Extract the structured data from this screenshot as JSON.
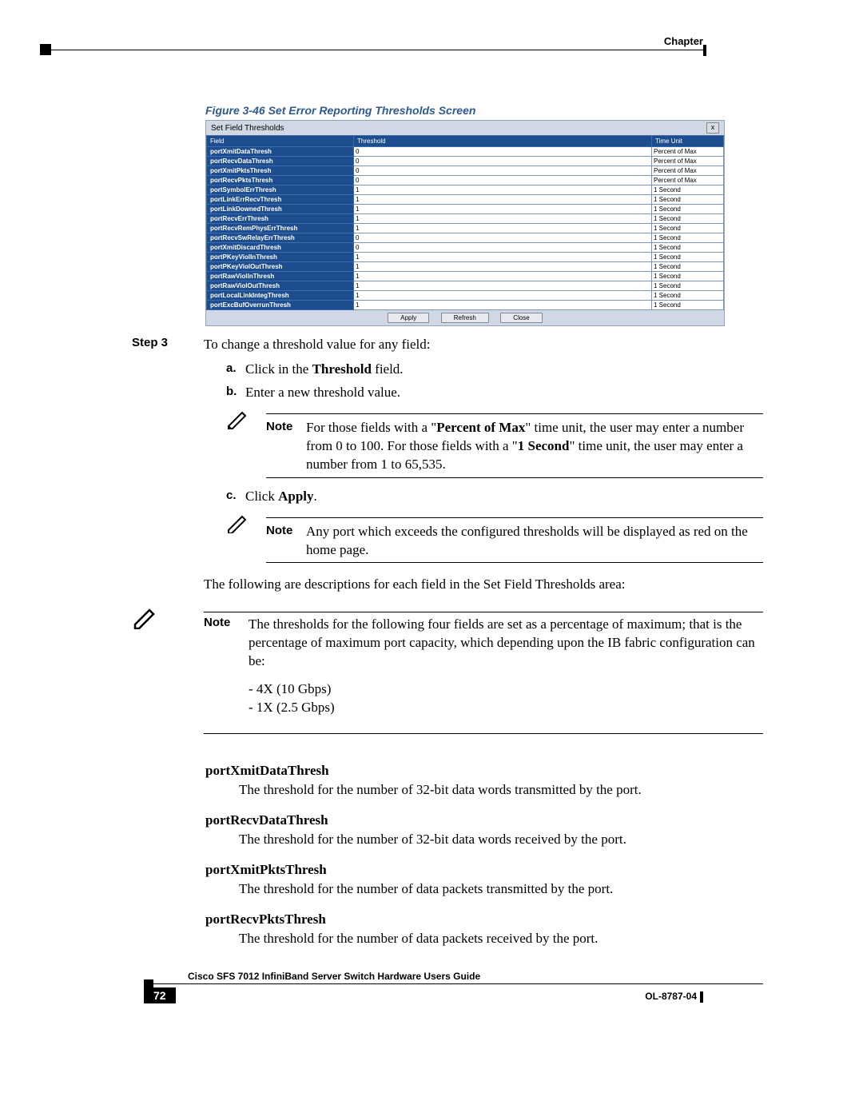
{
  "header": {
    "chapter": "Chapter"
  },
  "figure": {
    "caption": "Figure 3-46      Set Error Reporting Thresholds Screen"
  },
  "screenshot": {
    "title": "Set Field Thresholds",
    "close": "x",
    "headers": {
      "field": "Field",
      "threshold": "Threshold",
      "timeunit": "Time Unit"
    },
    "rows": [
      {
        "f": "portXmitDataThresh",
        "v": "0",
        "u": "Percent of Max"
      },
      {
        "f": "portRecvDataThresh",
        "v": "0",
        "u": "Percent of Max"
      },
      {
        "f": "portXmitPktsThresh",
        "v": "0",
        "u": "Percent of Max"
      },
      {
        "f": "portRecvPktsThresh",
        "v": "0",
        "u": "Percent of Max"
      },
      {
        "f": "portSymbolErrThresh",
        "v": "1",
        "u": "1 Second"
      },
      {
        "f": "portLinkErrRecvThresh",
        "v": "1",
        "u": "1 Second"
      },
      {
        "f": "portLinkDownedThresh",
        "v": "1",
        "u": "1 Second"
      },
      {
        "f": "portRecvErrThresh",
        "v": "1",
        "u": "1 Second"
      },
      {
        "f": "portRecvRemPhysErrThresh",
        "v": "1",
        "u": "1 Second"
      },
      {
        "f": "portRecvSwRelayErrThresh",
        "v": "0",
        "u": "1 Second"
      },
      {
        "f": "portXmitDiscardThresh",
        "v": "0",
        "u": "1 Second"
      },
      {
        "f": "portPKeyViolInThresh",
        "v": "1",
        "u": "1 Second"
      },
      {
        "f": "portPKeyViolOutThresh",
        "v": "1",
        "u": "1 Second"
      },
      {
        "f": "portRawViolInThresh",
        "v": "1",
        "u": "1 Second"
      },
      {
        "f": "portRawViolOutThresh",
        "v": "1",
        "u": "1 Second"
      },
      {
        "f": "portLocalLinkIntegThresh",
        "v": "1",
        "u": "1 Second"
      },
      {
        "f": "portExcBufOverrunThresh",
        "v": "1",
        "u": "1 Second"
      }
    ],
    "buttons": {
      "apply": "Apply",
      "refresh": "Refresh",
      "close": "Close"
    }
  },
  "step": {
    "label": "Step 3",
    "text": "To change a threshold value for any field:",
    "a": {
      "l": "a.",
      "pre": "Click in the ",
      "bold": "Threshold",
      "post": " field."
    },
    "b": {
      "l": "b.",
      "t": "Enter a new threshold value."
    },
    "c": {
      "l": "c.",
      "pre": "Click ",
      "bold": "Apply",
      "post": "."
    }
  },
  "notes": {
    "label": "Note",
    "n1a": "For those fields with a \"",
    "n1b": "Percent of Max",
    "n1c": "\" time unit, the user may enter a number from 0 to 100. For those fields with a \"",
    "n1d": "1 Second",
    "n1e": "\" time unit, the user may enter a number from 1 to 65,535.",
    "n2": "Any port which exceeds the configured thresholds will be displayed as red on the home page.",
    "n3": "The thresholds for the following four fields are set as a percentage of maximum; that is the percentage of maximum port capacity, which depending upon the IB fabric configuration can be:"
  },
  "desc_intro": "The following are descriptions for each field in the Set Field Thresholds area:",
  "speeds": {
    "s1": "- 4X (10 Gbps)",
    "s2": "- 1X (2.5 Gbps)"
  },
  "fields": [
    {
      "name": "portXmitDataThresh",
      "desc": "The threshold for the number of 32-bit data words transmitted by the port."
    },
    {
      "name": "portRecvDataThresh",
      "desc": "The threshold for the number of 32-bit data words received by the port."
    },
    {
      "name": "portXmitPktsThresh",
      "desc": "The threshold for the number of data packets transmitted by the port."
    },
    {
      "name": "portRecvPktsThresh",
      "desc": "The threshold for the number of data packets received by the port."
    }
  ],
  "footer": {
    "guide": "Cisco SFS 7012 InfiniBand Server Switch Hardware Users Guide",
    "page": "72",
    "ol": "OL-8787-04"
  }
}
